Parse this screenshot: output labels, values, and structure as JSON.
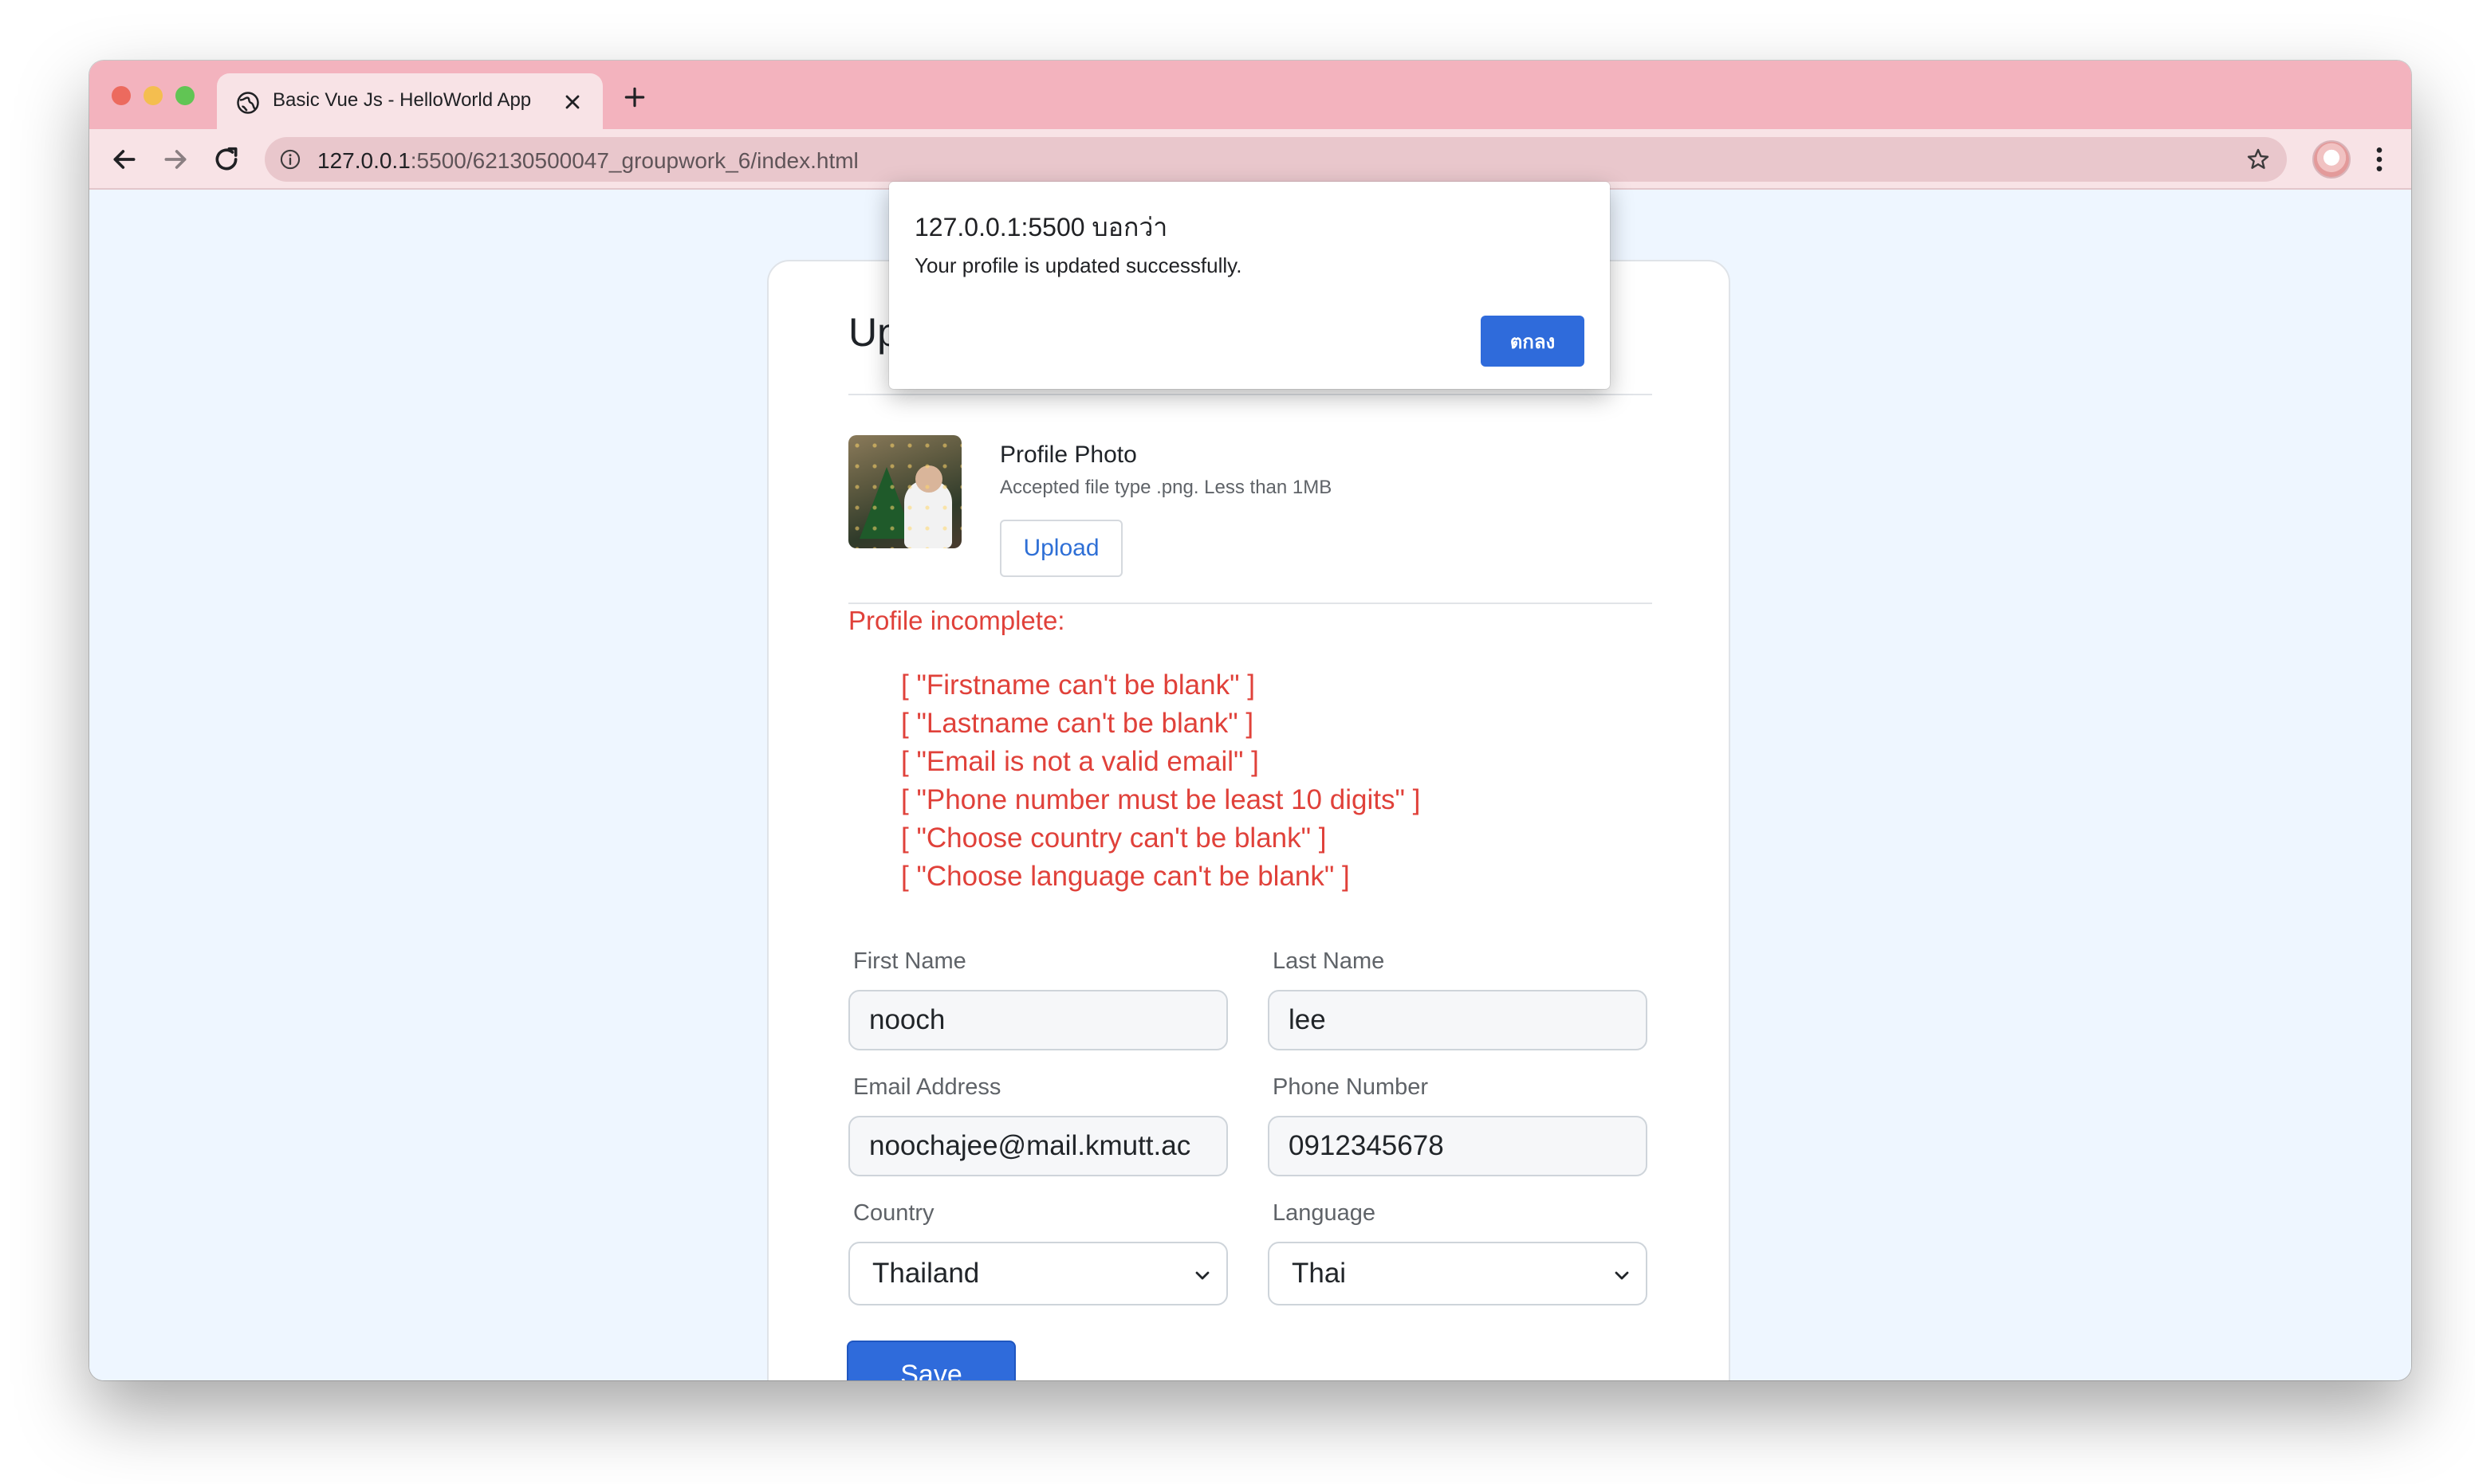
{
  "browser": {
    "tab_title": "Basic Vue Js - HelloWorld App",
    "url_host": "127.0.0.1",
    "url_rest": ":5500/62130500047_groupwork_6/index.html"
  },
  "dialog": {
    "origin": "127.0.0.1:5500 บอกว่า",
    "message": "Your profile is updated successfully.",
    "ok_label": "ตกลง"
  },
  "page": {
    "heading": "Up",
    "photo": {
      "title": "Profile Photo",
      "hint": "Accepted file type .png. Less than 1MB",
      "upload_label": "Upload"
    },
    "errors": {
      "title": "Profile incomplete:",
      "items": [
        "[ \"Firstname can't be blank\" ]",
        "[ \"Lastname can't be blank\" ]",
        "[ \"Email is not a valid email\" ]",
        "[ \"Phone number must be least 10 digits\" ]",
        "[ \"Choose country can't be blank\" ]",
        "[ \"Choose language can't be blank\" ]"
      ]
    },
    "form": {
      "first_name": {
        "label": "First Name",
        "value": "nooch"
      },
      "last_name": {
        "label": "Last Name",
        "value": "lee"
      },
      "email": {
        "label": "Email Address",
        "value": "noochajee@mail.kmutt.ac"
      },
      "phone": {
        "label": "Phone Number",
        "value": "0912345678"
      },
      "country": {
        "label": "Country",
        "value": "Thailand"
      },
      "language": {
        "label": "Language",
        "value": "Thai"
      },
      "save_label": "Save"
    }
  },
  "colors": {
    "accent": "#2f6bdb",
    "error": "#e0413a",
    "titlebar": "#f3b3be",
    "page_background": "#eef6ff"
  }
}
